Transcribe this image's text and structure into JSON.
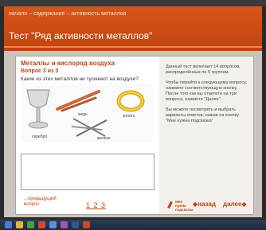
{
  "app": {
    "breadcrumb": "начало – содержание – активность металлов",
    "title": "Тест \"Ряд активности металлов\""
  },
  "question": {
    "section_title": "Металлы и кислород воздуха",
    "number": "Вопрос 3 из 3",
    "text": "Какие из этих металлов не тускнеют на воздухе?",
    "images": [
      {
        "label": "серебро"
      },
      {
        "label": "медь"
      },
      {
        "label": "железо"
      },
      {
        "label": "золото"
      }
    ]
  },
  "navigation": {
    "prev_label": "...предыдущий вопрос",
    "pages": "1 2 3",
    "hint_label": "Мне нужна подсказка",
    "back_label": "◆назад",
    "next_label": "далее◆"
  },
  "help": {
    "p1": "Данный тест включает 14 вопросов, распределённых по 5 группам.",
    "p2": "Чтобы перейти к следующему вопросу, нажмите соответствующую кнопку. После того как вы ответите на три вопроса, нажмите \"Далее\".",
    "p3": "Вы можете посмотреть и выбрать варианты ответов, нажав на кнопку \"Мне нужна подсказка\""
  },
  "colors": {
    "accent": "#c0430f",
    "header": "#d8551a"
  }
}
